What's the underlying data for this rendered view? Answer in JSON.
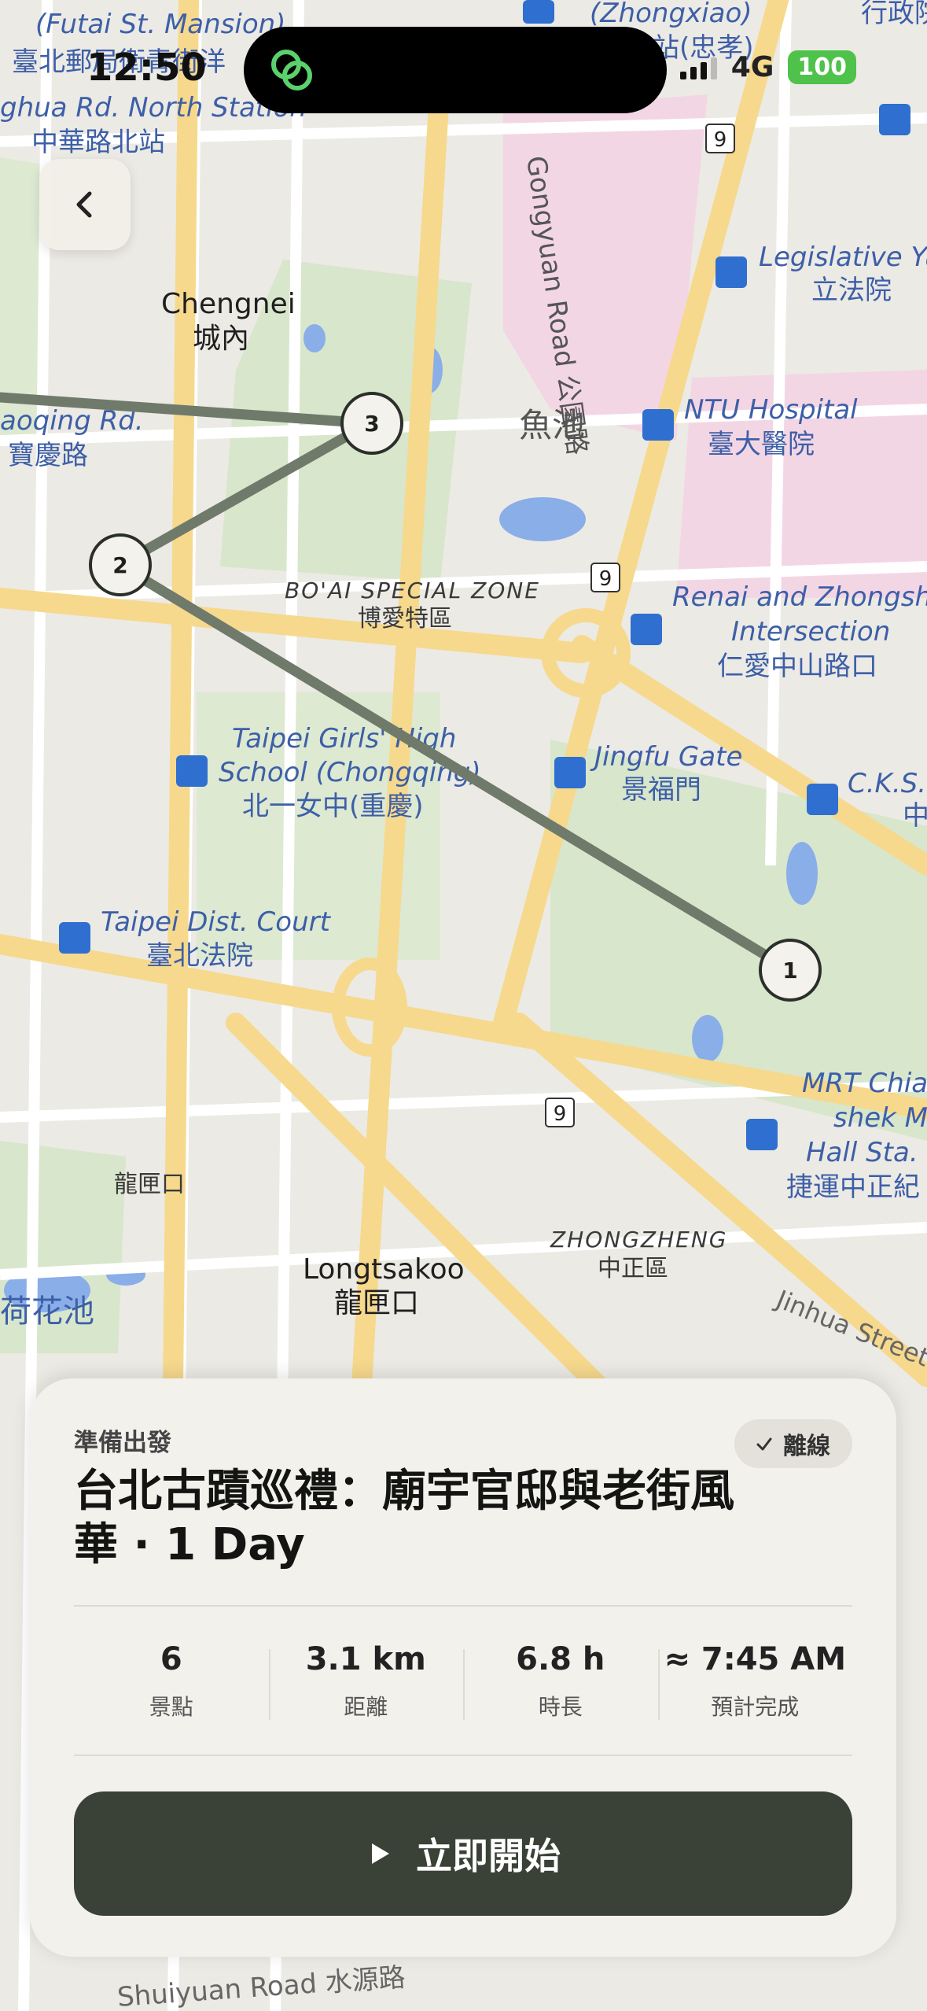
{
  "status_bar": {
    "time": "12:50",
    "network": "4G",
    "battery": "100"
  },
  "map": {
    "labels": {
      "futai_en": "(Futai St. Mansion)",
      "futai_zh": "臺北郵局衛青街洋",
      "zhongxiao_en": "(Zhongxiao)",
      "zhongxiao_zh": "站(忠孝)",
      "zhonghua_en": "ghua Rd. North Station",
      "zhonghua_zh": "中華路北站",
      "top_right_zh": "行政院",
      "legislative_en": "Legislative Yuan",
      "legislative_zh": "立法院",
      "chengnei_en": "Chengnei",
      "chengnei_zh": "城內",
      "gongyuan_road": "Gongyuan Road 公園路",
      "yuchi": "魚池",
      "ntu_en": "NTU Hospital",
      "ntu_zh": "臺大醫院",
      "baoqing_en": "aoqing Rd.",
      "baoqing_zh": "寶慶路",
      "boai_en": "BO'AI SPECIAL ZONE",
      "boai_zh": "博愛特區",
      "renai_en1": "Renai and Zhongshan",
      "renai_en2": "Intersection",
      "renai_zh": "仁愛中山路口",
      "girls_en1": "Taipei Girls' High",
      "girls_en2": "School (Chongqing)",
      "girls_zh": "北一女中(重慶)",
      "jingfu_en": "Jingfu Gate",
      "jingfu_zh": "景福門",
      "cks_en": "C.K.S.",
      "cks_zh": "中",
      "court_en": "Taipei Dist. Court",
      "court_zh": "臺北法院",
      "mrt_en1": "MRT Chiang",
      "mrt_en2": "shek Mem",
      "mrt_en3": "Hall Sta. (A",
      "mrt_zh": "捷運中正紀",
      "longkuang_small": "龍匣口",
      "longtsakoo_en": "Longtsakoo",
      "longtsakoo_zh": "龍匣口",
      "zhongzheng_en": "ZHONGZHENG",
      "zhongzheng_zh": "中正區",
      "jinhua": "Jinhua Street",
      "hehua": "荷花池",
      "shuiyuan": "Shuiyuan Road 水源路",
      "route9": "9"
    },
    "markers": [
      "1",
      "2",
      "3"
    ]
  },
  "sheet": {
    "eyebrow": "準備出發",
    "offline_label": "離線",
    "title": "台北古蹟巡禮：廟宇官邸與老街風華 · 1 Day",
    "stats": [
      {
        "value": "6",
        "label": "景點"
      },
      {
        "value": "3.1 km",
        "label": "距離"
      },
      {
        "value": "6.8 h",
        "label": "時長"
      },
      {
        "value": "≈ 7:45 AM",
        "label": "預計完成"
      }
    ],
    "start_label": "立即開始"
  }
}
